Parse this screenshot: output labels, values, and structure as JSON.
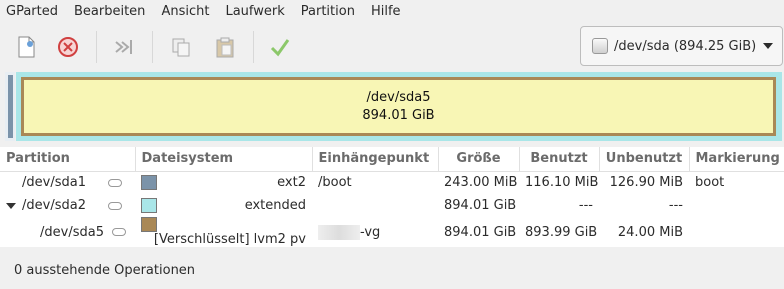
{
  "menu": [
    "GParted",
    "Bearbeiten",
    "Ansicht",
    "Laufwerk",
    "Partition",
    "Hilfe"
  ],
  "toolbar": {
    "icons": [
      "new-partition-icon",
      "delete-partition-icon",
      "resize-move-icon",
      "copy-icon",
      "paste-icon",
      "apply-icon"
    ]
  },
  "device": {
    "label": "/dev/sda (894.25 GiB)"
  },
  "diskmap": {
    "name": "/dev/sda5",
    "size": "894.01 GiB"
  },
  "table": {
    "headers": [
      "Partition",
      "Dateisystem",
      "Einhängepunkt",
      "Größe",
      "Benutzt",
      "Unbenutzt",
      "Markierung"
    ],
    "rows": [
      {
        "partition": "/dev/sda1",
        "fs": "ext2",
        "fs_color": "#7b93a9",
        "mount": "/boot",
        "size": "243.00 MiB",
        "used": "116.10 MiB",
        "unused": "126.90 MiB",
        "flags": "boot"
      },
      {
        "partition": "/dev/sda2",
        "fs": "extended",
        "fs_color": "#a9e6e8",
        "mount": "",
        "size": "894.01 GiB",
        "used": "---",
        "unused": "---",
        "flags": ""
      },
      {
        "partition": "/dev/sda5",
        "fs": "[Verschlüsselt] lvm2 pv",
        "fs_color": "#a98856",
        "mount": "-vg",
        "size": "894.01 GiB",
        "used": "893.99 GiB",
        "unused": "24.00 MiB",
        "flags": ""
      }
    ]
  },
  "status": "0 ausstehende Operationen"
}
